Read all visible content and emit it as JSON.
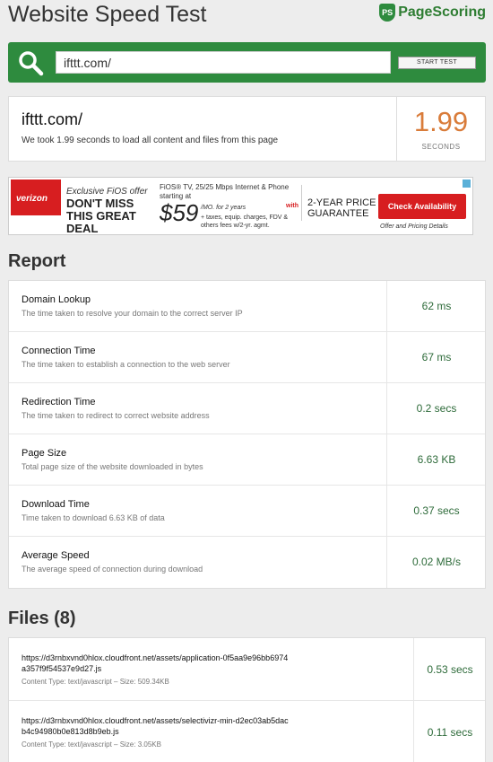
{
  "header": {
    "title": "Website Speed Test",
    "logo_badge": "PS",
    "logo_text": "PageScoring"
  },
  "search": {
    "value": "ifttt.com/",
    "button_label": "START TEST"
  },
  "summary": {
    "url": "ifttt.com/",
    "description": "We took 1.99 seconds to load all content and files from this page",
    "value": "1.99",
    "unit": "SECONDS"
  },
  "ad": {
    "brand": "verizon",
    "offer": "Exclusive FiOS offer",
    "headline": "DON'T MISS THIS GREAT DEAL",
    "fios": "FiOS® TV, 25/25 Mbps Internet & Phone starting at",
    "price": "$59",
    "per_month": "/MO. for 2 years",
    "fees": "+ taxes, equip. charges, FDV & others fees w/2-yr. agmt.",
    "with": "with",
    "guarantee": "2-YEAR PRICE GUARANTEE",
    "cta": "Check Availability",
    "details": "Offer and Pricing Details"
  },
  "report": {
    "heading": "Report",
    "rows": [
      {
        "name": "Domain Lookup",
        "desc": "The time taken to resolve your domain to the correct server IP",
        "value": "62 ms"
      },
      {
        "name": "Connection Time",
        "desc": "The time taken to establish a connection to the web server",
        "value": "67 ms"
      },
      {
        "name": "Redirection Time",
        "desc": "The time taken to redirect to correct website address",
        "value": "0.2 secs"
      },
      {
        "name": "Page Size",
        "desc": "Total page size of the website downloaded in bytes",
        "value": "6.63 KB"
      },
      {
        "name": "Download Time",
        "desc": "Time taken to download 6.63 KB of data",
        "value": "0.37 secs"
      },
      {
        "name": "Average Speed",
        "desc": "The average speed of connection during download",
        "value": "0.02 MB/s"
      }
    ]
  },
  "files": {
    "heading": "Files (8)",
    "rows": [
      {
        "url": "https://d3rnbxvnd0hlox.cloudfront.net/assets/application-0f5aa9e96bb6974a357f9f54537e9d27.js",
        "meta": "Content Type: text/javascript – Size: 509.34KB",
        "value": "0.53 secs"
      },
      {
        "url": "https://d3rnbxvnd0hlox.cloudfront.net/assets/selectivizr-min-d2ec03ab5dacb4c94980b0e813d8b9eb.js",
        "meta": "Content Type: text/javascript – Size: 3.05KB",
        "value": "0.11 secs"
      }
    ]
  }
}
